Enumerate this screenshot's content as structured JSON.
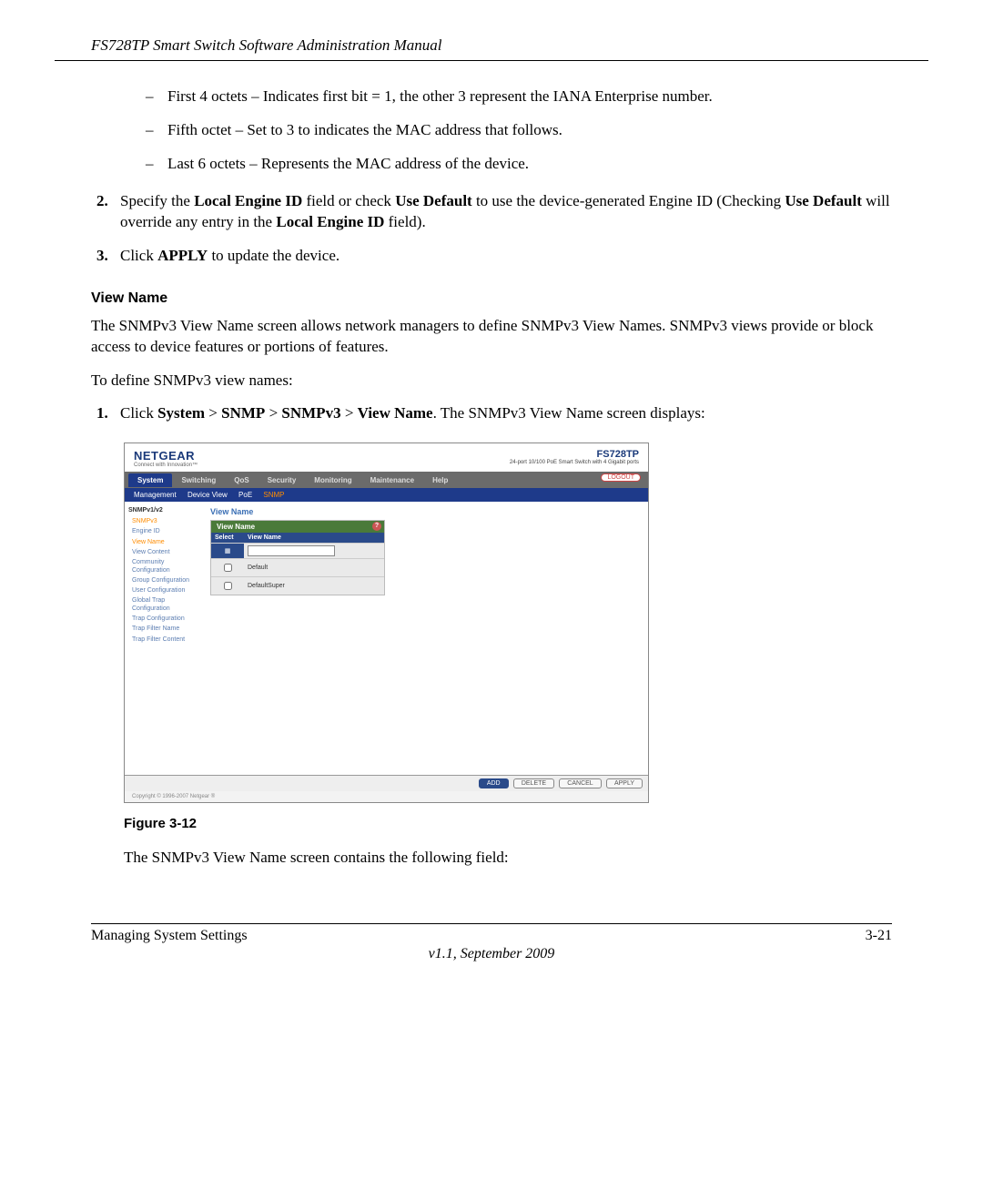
{
  "header": {
    "title": "FS728TP Smart Switch Software Administration Manual"
  },
  "bullets": {
    "b1": "First 4 octets – Indicates first bit = 1, the other 3 represent the IANA Enterprise number.",
    "b2": "Fifth octet – Set to 3 to indicates the MAC address that follows.",
    "b3": "Last 6 octets – Represents the MAC address of the device."
  },
  "steps_a": {
    "n2": "2.",
    "t2_pre": "Specify the ",
    "t2_b1": "Local Engine ID",
    "t2_mid1": " field or check ",
    "t2_b2": "Use Default",
    "t2_mid2": " to use the device-generated Engine ID (Checking ",
    "t2_b3": "Use Default",
    "t2_mid3": " will override any entry in the ",
    "t2_b4": "Local Engine ID",
    "t2_end": " field).",
    "n3": "3.",
    "t3_pre": "Click ",
    "t3_b": "APPLY",
    "t3_end": " to update the device."
  },
  "section": {
    "title": "View Name"
  },
  "para1": "The SNMPv3 View Name screen allows network managers to define SNMPv3 View Names. SNMPv3 views provide or block access to device features or portions of features.",
  "para2": "To define SNMPv3 view names:",
  "steps_b": {
    "n1": "1.",
    "pre": "Click ",
    "b1": "System",
    "gt1": " > ",
    "b2": "SNMP",
    "gt2": " > ",
    "b3": "SNMPv3",
    "gt3": " > ",
    "b4": "View Name",
    "end": ". The SNMPv3 View Name screen displays:"
  },
  "shot": {
    "logo": "NETGEAR",
    "tagline": "Connect with Innovation™",
    "model": "FS728TP",
    "model_desc": "24-port 10/100 PoE Smart Switch with 4 Gigabit ports",
    "tabs": [
      "System",
      "Switching",
      "QoS",
      "Security",
      "Monitoring",
      "Maintenance",
      "Help"
    ],
    "logout": "LOGOUT",
    "subtabs": {
      "items": [
        "Management",
        "Device View",
        "PoE",
        "SNMP"
      ],
      "selected": "SNMP"
    },
    "side_group": "SNMPv1/v2",
    "side_links": [
      "SNMPv3",
      "Engine ID",
      "View Name",
      "View Content",
      "Community Configuration",
      "Group Configuration",
      "User Configuration",
      "Global Trap Configuration",
      "Trap Configuration",
      "Trap Filter Name",
      "Trap Filter Content"
    ],
    "side_selected": "View Name",
    "panel_title": "View Name",
    "panel_head": "View Name",
    "col_select": "Select",
    "col_view": "View Name",
    "rows": [
      "Default",
      "DefaultSuper"
    ],
    "buttons": {
      "add": "ADD",
      "delete": "DELETE",
      "cancel": "CANCEL",
      "apply": "APPLY"
    },
    "copyright": "Copyright © 1996-2007 Netgear ®"
  },
  "figure": {
    "caption": "Figure 3-12"
  },
  "para3": "The SNMPv3 View Name screen contains the following field:",
  "footer": {
    "left": "Managing System Settings",
    "right": "3-21",
    "version": "v1.1, September 2009"
  }
}
